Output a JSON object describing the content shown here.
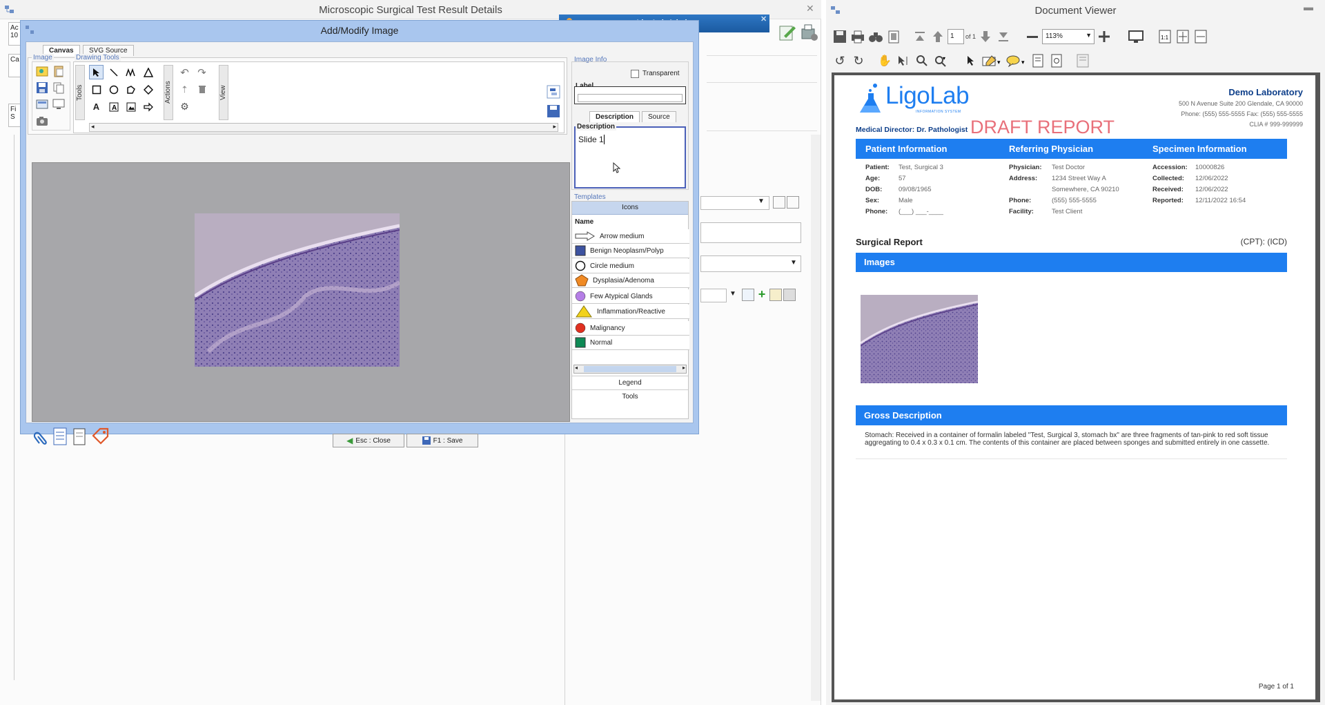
{
  "bg_window": {
    "title": "Microscopic Surgical Test Result Details",
    "left_labels": [
      "Ac",
      "10",
      "Ca",
      "Fi",
      "S"
    ]
  },
  "dialog": {
    "title": "Add/Modify Image",
    "tabs": [
      "Canvas",
      "SVG Source"
    ],
    "groups": {
      "image": "Image",
      "drawing_tools": "Drawing Tools"
    },
    "vertical_labels": {
      "tools": "Tools",
      "actions": "Actions",
      "view": "View"
    },
    "image_info": {
      "group_label": "Image Info",
      "transparent_label": "Transparent",
      "transparent_checked": false,
      "label_label": "Label",
      "label_value": "",
      "subtabs": [
        "Description",
        "Source"
      ],
      "description_label": "Description",
      "description_value": "Slide 1"
    },
    "templates": {
      "group_label": "Templates",
      "header": "Icons",
      "name_col": "Name",
      "items": [
        {
          "name": "Arrow medium",
          "icon": "arrow-outline-icon",
          "color": "#ffffff"
        },
        {
          "name": "Benign Neoplasm/Polyp",
          "icon": "square-icon",
          "color": "#3c52a0"
        },
        {
          "name": "Circle medium",
          "icon": "circle-outline-icon",
          "color": "#ffffff"
        },
        {
          "name": "Dysplasia/Adenoma",
          "icon": "pentagon-icon",
          "color": "#f08a24"
        },
        {
          "name": "Few Atypical Glands",
          "icon": "circle-icon",
          "color": "#b57ee6"
        },
        {
          "name": "Inflammation/Reactive",
          "icon": "triangle-icon",
          "color": "#f2d21a"
        },
        {
          "name": "Malignancy",
          "icon": "circle-icon",
          "color": "#e03020"
        },
        {
          "name": "Normal",
          "icon": "square-icon",
          "color": "#0e8a55"
        }
      ],
      "footer_buttons": [
        "Legend",
        "Tools"
      ]
    },
    "buttons": {
      "close": "Esc : Close",
      "save": "F1 : Save"
    }
  },
  "admin_bar": {
    "title": "LigoLab Admin"
  },
  "doc_viewer": {
    "title": "Document Viewer",
    "page_input": "1",
    "page_of": "of 1",
    "zoom": "113%",
    "report": {
      "logo_text": "LigoLab",
      "logo_sub": "INFORMATION SYSTEM",
      "lab_name": "Demo Laboratory",
      "lab_address": "500 N Avenue Suite 200 Glendale, CA 90000",
      "lab_phone": "Phone: (555) 555-5555  Fax: (555) 555-5555",
      "lab_clia": "CLIA # 999-999999",
      "medical_director_label": "Medical Director:",
      "medical_director": "Dr. Pathologist",
      "draft": "DRAFT REPORT",
      "headers": [
        "Patient Information",
        "Referring Physician",
        "Specimen Information"
      ],
      "patient": [
        {
          "label": "Patient:",
          "value": "Test, Surgical 3"
        },
        {
          "label": "Age:",
          "value": "57"
        },
        {
          "label": "DOB:",
          "value": "09/08/1965"
        },
        {
          "label": "Sex:",
          "value": "Male"
        },
        {
          "label": "Phone:",
          "value": "(___) ___-____"
        }
      ],
      "physician": [
        {
          "label": "Physician:",
          "value": "Test Doctor"
        },
        {
          "label": "Address:",
          "value": "1234 Street Way A"
        },
        {
          "label": "",
          "value": "Somewhere, CA 90210"
        },
        {
          "label": "Phone:",
          "value": "(555) 555-5555"
        },
        {
          "label": "Facility:",
          "value": "Test Client"
        }
      ],
      "specimen": [
        {
          "label": "Accession:",
          "value": "10000826"
        },
        {
          "label": "Collected:",
          "value": "12/06/2022"
        },
        {
          "label": "Received:",
          "value": "12/06/2022"
        },
        {
          "label": "Reported:",
          "value": "12/11/2022 16:54"
        }
      ],
      "surgical_report": "Surgical Report",
      "cpt_icd": "(CPT):  (ICD)",
      "images_header": "Images",
      "gross_header": "Gross Description",
      "gross_text": "Stomach: Received in a container of formalin labeled \"Test, Surgical 3, stomach bx\" are three fragments of tan-pink to red soft tissue aggregating to 0.4 x 0.3 x 0.1 cm. The contents of this container are placed between sponges and submitted entirely in one cassette.",
      "page_footer": "Page 1 of 1"
    }
  },
  "colors": {
    "report_blue": "#1e7ef0",
    "draft_red": "#e8707a",
    "dialog_frame": "#a9c6ee"
  }
}
